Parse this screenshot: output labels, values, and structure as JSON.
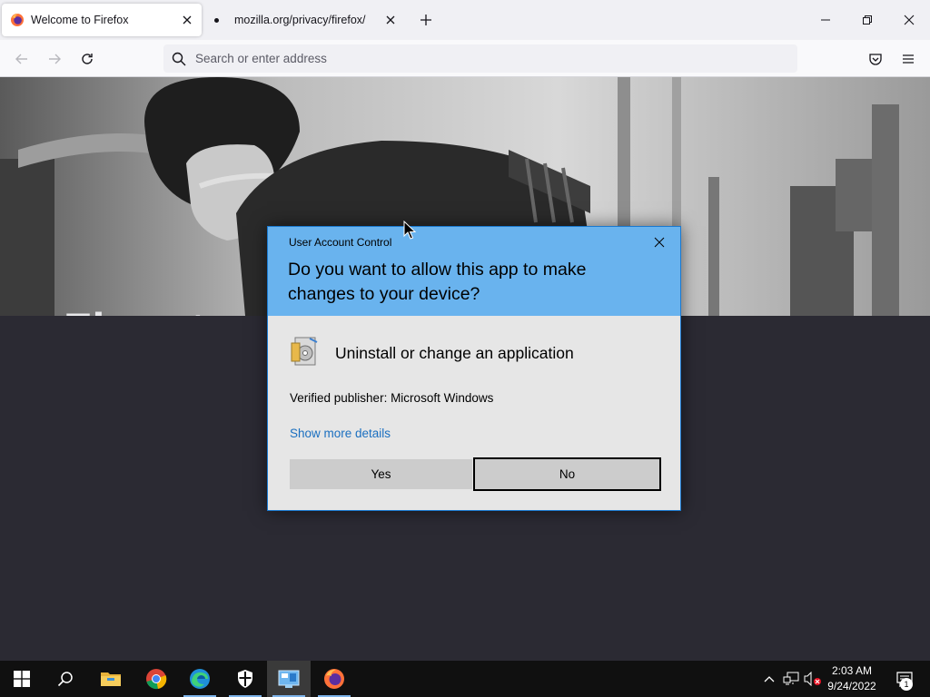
{
  "browser": {
    "tabs": [
      {
        "title": "Welcome to Firefox",
        "active": true
      },
      {
        "title": "mozilla.org/privacy/firefox/",
        "active": false
      }
    ],
    "new_tab_icon": "plus-icon",
    "window_controls": [
      "minimize-icon",
      "restore-icon",
      "close-icon"
    ],
    "nav": {
      "back_icon": "arrow-left-icon",
      "forward_icon": "arrow-right-icon",
      "reload_icon": "reload-icon",
      "address_placeholder": "Search or enter address",
      "address_value": "",
      "pocket_icon": "pocket-icon",
      "menu_icon": "hamburger-menu-icon"
    }
  },
  "page": {
    "hero_heading_partial": "Fire sta"
  },
  "uac": {
    "caption": "User Account Control",
    "question": "Do you want to allow this app to make changes to your device?",
    "app_name": "Uninstall or change an application",
    "publisher": "Verified publisher: Microsoft Windows",
    "details_link": "Show more details",
    "yes_label": "Yes",
    "no_label": "No",
    "header_color": "#69b3ee",
    "link_color": "#1a6fc0"
  },
  "taskbar": {
    "apps": [
      "start-icon",
      "search-icon",
      "file-explorer-icon",
      "chrome-icon",
      "edge-icon",
      "windows-security-icon",
      "control-panel-icon",
      "firefox-icon"
    ],
    "tray": [
      "chevron-up-icon",
      "network-icon",
      "volume-muted-icon"
    ],
    "time": "2:03 AM",
    "date": "9/24/2022",
    "notification_count": "1"
  }
}
